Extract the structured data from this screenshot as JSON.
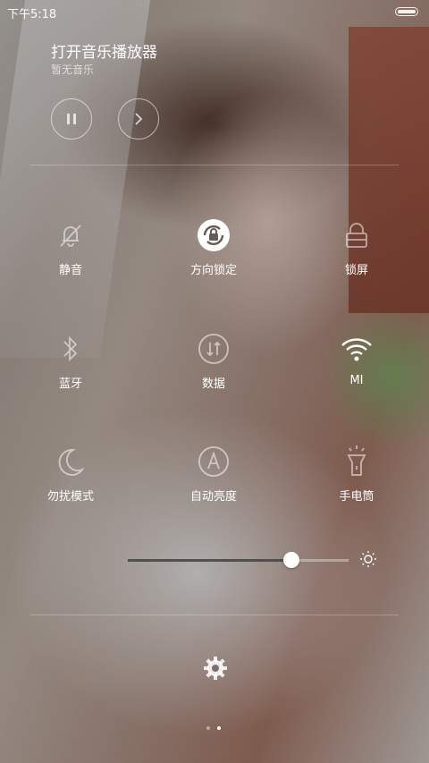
{
  "status_bar": {
    "time": "下午5:18"
  },
  "music": {
    "title": "打开音乐播放器",
    "subtitle": "暂无音乐",
    "icons": [
      "pause-icon",
      "next-icon"
    ]
  },
  "toggles": [
    {
      "label": "静音",
      "icon": "bell-off-icon",
      "active": false
    },
    {
      "label": "方向锁定",
      "icon": "rotation-lock-icon",
      "active": true
    },
    {
      "label": "锁屏",
      "icon": "lock-icon",
      "active": false
    },
    {
      "label": "蓝牙",
      "icon": "bluetooth-icon",
      "active": false
    },
    {
      "label": "数据",
      "icon": "data-icon",
      "active": false
    },
    {
      "label": "MI",
      "icon": "wifi-icon",
      "active": true
    },
    {
      "label": "勿扰模式",
      "icon": "moon-icon",
      "active": false
    },
    {
      "label": "自动亮度",
      "icon": "auto-brightness-icon",
      "active": false
    },
    {
      "label": "手电筒",
      "icon": "flashlight-icon",
      "active": false
    }
  ],
  "brightness": {
    "level": 0.74,
    "icon": "sun-icon"
  },
  "settings": {
    "icon": "gear-icon"
  },
  "pagination": {
    "pages": 2,
    "current": 2
  }
}
